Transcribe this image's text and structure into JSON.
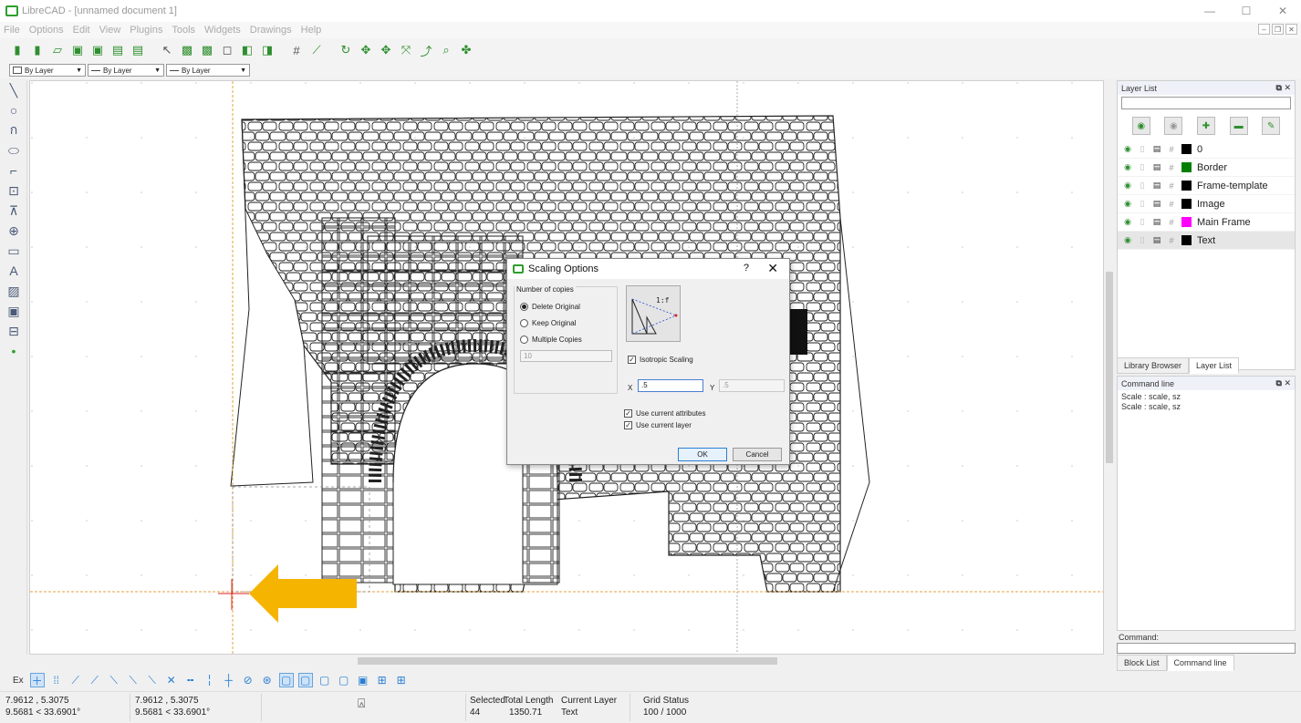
{
  "window": {
    "title": "LibreCAD - [unnamed document 1]",
    "minimize": "—",
    "maximize": "☐",
    "close": "✕"
  },
  "menu": [
    "File",
    "Options",
    "Edit",
    "View",
    "Plugins",
    "Tools",
    "Widgets",
    "Drawings",
    "Help"
  ],
  "attributes_bar": {
    "color": "By Layer",
    "line_type": "By Layer",
    "line_width": "By Layer"
  },
  "layer_list": {
    "title": "Layer List",
    "layers": [
      {
        "name": "0",
        "color": "#000000",
        "selected": false
      },
      {
        "name": "Border",
        "color": "#007f00",
        "selected": false
      },
      {
        "name": "Frame-template",
        "color": "#000000",
        "selected": false
      },
      {
        "name": "Image",
        "color": "#000000",
        "selected": false
      },
      {
        "name": "Main Frame",
        "color": "#ff00ff",
        "selected": false
      },
      {
        "name": "Text",
        "color": "#000000",
        "selected": true
      }
    ],
    "tabs": [
      "Library Browser",
      "Layer List"
    ]
  },
  "command_line": {
    "title": "Command line",
    "history": [
      "Scale : scale, sz",
      "Scale : scale, sz"
    ],
    "prompt_label": "Command:",
    "tabs": [
      "Block List",
      "Command line"
    ]
  },
  "dialog": {
    "title": "Scaling Options",
    "help": "?",
    "close": "✕",
    "group_label": "Number of copies",
    "options": [
      "Delete Original",
      "Keep Original",
      "Multiple Copies"
    ],
    "selected_option": "Delete Original",
    "copies_value": "10",
    "preview_label": "1:f",
    "isotropic_label": "Isotropic Scaling",
    "isotropic_checked": true,
    "x_label": "X",
    "x_value": ".5",
    "y_label": "Y",
    "y_value": ".5",
    "use_attributes_label": "Use current attributes",
    "use_layer_label": "Use current layer",
    "ok_label": "OK",
    "cancel_label": "Cancel"
  },
  "snap_toolbar": {
    "ex_label": "Ex"
  },
  "status": {
    "coord_abs_1": "7.9612 , 5.3075",
    "coord_abs_2": "9.5681 < 33.6901°",
    "coord_rel_1": "7.9612 , 5.3075",
    "coord_rel_2": "9.5681 < 33.6901°",
    "selected_label": "Selected",
    "selected_value": "44",
    "total_length_label": "Total Length",
    "total_length_value": "1350.71",
    "current_layer_label": "Current Layer",
    "current_layer_value": "Text",
    "grid_status_label": "Grid Status",
    "grid_status_value": "100 / 1000"
  },
  "colors": {
    "accent": "#2f9e2f",
    "arrow": "#f5b400",
    "selection_blue": "#2a7fd4"
  }
}
